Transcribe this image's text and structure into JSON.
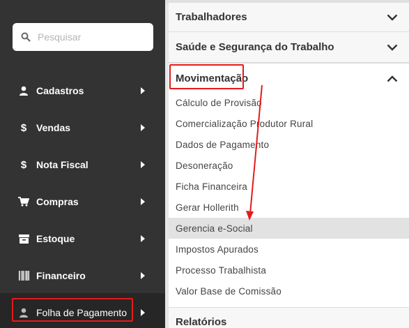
{
  "sidebar": {
    "search": {
      "placeholder": "Pesquisar"
    },
    "items": [
      {
        "label": "Cadastros",
        "icon": "user-icon"
      },
      {
        "label": "Vendas",
        "icon": "dollar-icon"
      },
      {
        "label": "Nota Fiscal",
        "icon": "dollar-icon"
      },
      {
        "label": "Compras",
        "icon": "cart-icon"
      },
      {
        "label": "Estoque",
        "icon": "archive-icon"
      },
      {
        "label": "Financeiro",
        "icon": "barcode-icon"
      },
      {
        "label": "Folha de Pagamento",
        "icon": "user-icon"
      }
    ]
  },
  "panel": {
    "sections": [
      {
        "label": "Trabalhadores",
        "state": "collapsed"
      },
      {
        "label": "Saúde e Segurança do Trabalho",
        "state": "collapsed"
      },
      {
        "label": "Movimentação",
        "state": "expanded"
      },
      {
        "label": "Relatórios",
        "state": "collapsed"
      }
    ],
    "movimentacao_items": [
      "Cálculo de Provisão",
      "Comercialização Produtor Rural",
      "Dados de Pagamento",
      "Desoneração",
      "Ficha Financeira",
      "Gerar Hollerith",
      "Gerencia e-Social",
      "Impostos Apurados",
      "Processo Trabalhista",
      "Valor Base de Comissão"
    ],
    "active_item": "Gerencia e-Social"
  },
  "colors": {
    "sidebar_bg": "#333333",
    "highlight_red": "#e41b1b",
    "active_row": "#e2e2e2"
  }
}
